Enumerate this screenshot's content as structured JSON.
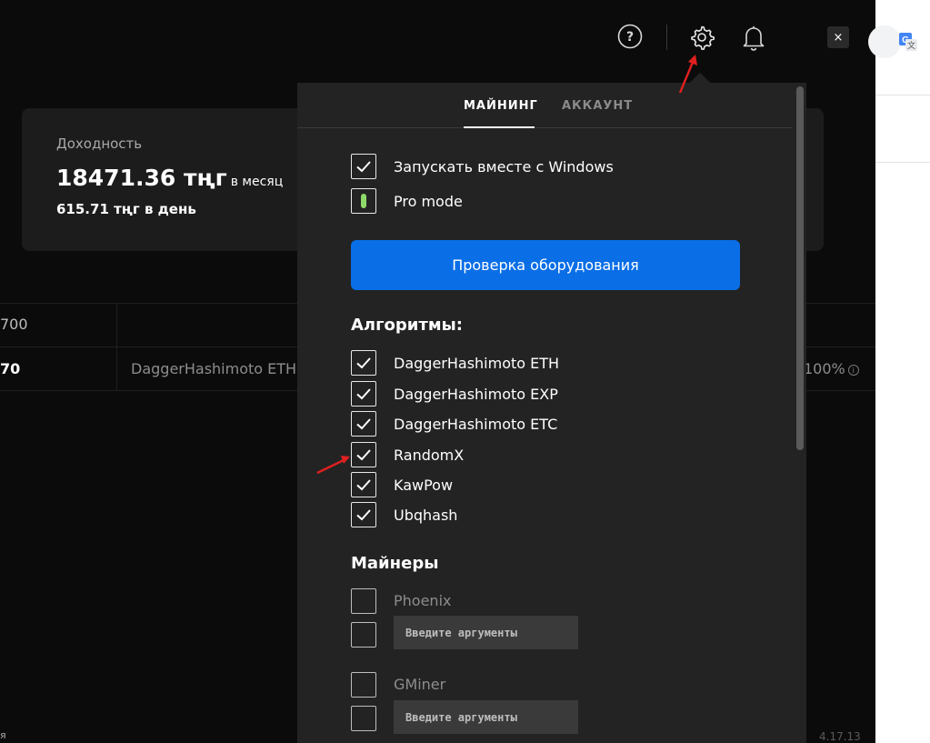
{
  "header": {
    "icons": [
      "help-icon",
      "gear-icon",
      "bell-icon"
    ],
    "close_label": "×"
  },
  "earnings": {
    "label": "Доходность",
    "monthly_value": "18471.36 тңг",
    "monthly_suffix": "в месяц",
    "daily": "615.71 тңг в день"
  },
  "table": {
    "row1_col1": "700",
    "row2_col1": "70",
    "row2_algo": "DaggerHashimoto ETH",
    "row2_percent": "100%"
  },
  "settings": {
    "tabs": [
      {
        "label": "МАЙНИНГ",
        "active": true
      },
      {
        "label": "АККАУНТ",
        "active": false
      }
    ],
    "options": [
      {
        "label": "Запускать вместе с Windows",
        "checked": true
      },
      {
        "label": "Pro mode",
        "toggle": true
      }
    ],
    "check_hardware_label": "Проверка оборудования",
    "algorithms_title": "Алгоритмы:",
    "algorithms": [
      {
        "label": "DaggerHashimoto ETH",
        "checked": true
      },
      {
        "label": "DaggerHashimoto EXP",
        "checked": true
      },
      {
        "label": "DaggerHashimoto ETC",
        "checked": true
      },
      {
        "label": "RandomX",
        "checked": true
      },
      {
        "label": "KawPow",
        "checked": true
      },
      {
        "label": "Ubqhash",
        "checked": true
      }
    ],
    "miners_title": "Майнеры",
    "miners": [
      {
        "label": "Phoenix",
        "checked": false,
        "args_placeholder": "Введите аргументы"
      },
      {
        "label": "GMiner",
        "checked": false,
        "args_placeholder": "Введите аргументы"
      }
    ]
  },
  "footer": {
    "version": "4.17.13",
    "left_mark": "я"
  },
  "colors": {
    "accent": "#0a6ee6",
    "panel_bg": "#232323",
    "app_bg": "#0b0b0b",
    "pro_indicator": "#8fd96a",
    "annotation_arrow": "#e02020"
  }
}
